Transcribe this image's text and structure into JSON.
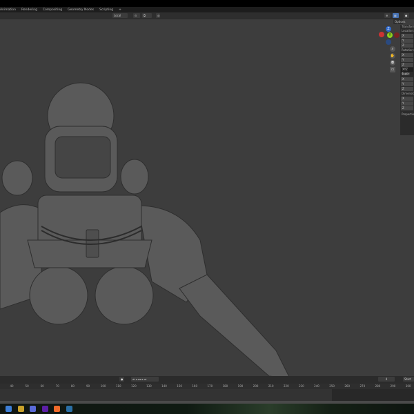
{
  "workspace_tabs": [
    "Animation",
    "Rendering",
    "Compositing",
    "Geometry Nodes",
    "Scripting",
    "+"
  ],
  "header": {
    "transform_orientation": "Local",
    "pivot_icon": "pivot-icon",
    "snap_icon": "snap-icon",
    "proportional_icon": "proportional-icon"
  },
  "options_label": "Options",
  "n_panel": {
    "section": "Transform",
    "location": "Location:",
    "rotation": "Rotation:",
    "rotation_mode": "XYZ Euler",
    "scale": "Scale:",
    "dimensions": "Dimensions:",
    "properties": "Properties",
    "axes": [
      "X",
      "Y",
      "Z"
    ]
  },
  "gizmo": {
    "x": "X",
    "y": "Y",
    "z": "Z"
  },
  "timeline": {
    "current_frame": "4",
    "start_label": "Start",
    "ruler": [
      "40",
      "50",
      "60",
      "70",
      "80",
      "90",
      "100",
      "110",
      "120",
      "130",
      "140",
      "150",
      "160",
      "170",
      "180",
      "190",
      "200",
      "210",
      "220",
      "230",
      "240",
      "250",
      "260",
      "270",
      "280",
      "290",
      "300"
    ]
  },
  "taskbar_icons": [
    {
      "name": "blender-launcher",
      "color": "#3e7fd6"
    },
    {
      "name": "app-yellow",
      "color": "#c9a12a"
    },
    {
      "name": "browser",
      "color": "#5a6ad8"
    },
    {
      "name": "app-purple",
      "color": "#5c1fa6"
    },
    {
      "name": "origin",
      "color": "#f06a2a"
    },
    {
      "name": "steam",
      "color": "#2a6fa6"
    }
  ]
}
